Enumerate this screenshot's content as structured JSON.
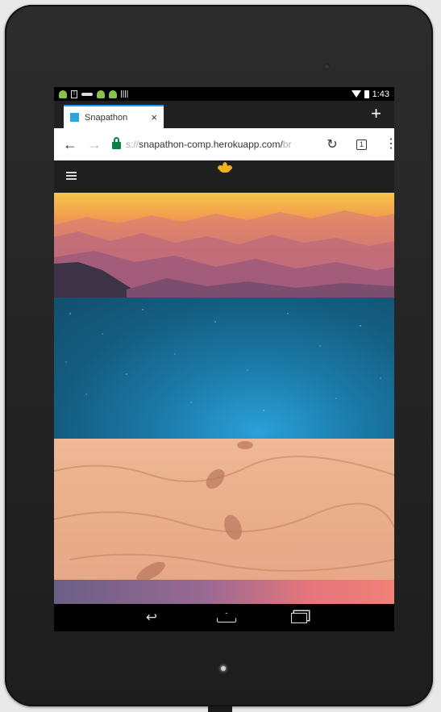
{
  "status": {
    "time": "1:43",
    "notification_icons": [
      "android-icon",
      "sim-icon",
      "key-icon",
      "android-icon",
      "android-icon",
      "barcode-icon"
    ]
  },
  "browser": {
    "tab": {
      "title": "Snapathon",
      "close": "×"
    },
    "new_tab": "+",
    "url": {
      "hidden": "s://",
      "visible": "snapathon-comp.herokuapp.com/",
      "faded": "br"
    },
    "tab_count": "1"
  },
  "site": {
    "menu_icon": "hamburger-icon",
    "logo_icon": "lotus-logo",
    "panels": [
      "mountain-sunset",
      "starry-sky",
      "sand-footprints",
      "gradient-strip"
    ],
    "colors": {
      "logo": "#f2b21b",
      "tab_accent": "#2196f3",
      "lock": "#0b8043"
    }
  },
  "system_nav": [
    "back",
    "home",
    "recents"
  ]
}
